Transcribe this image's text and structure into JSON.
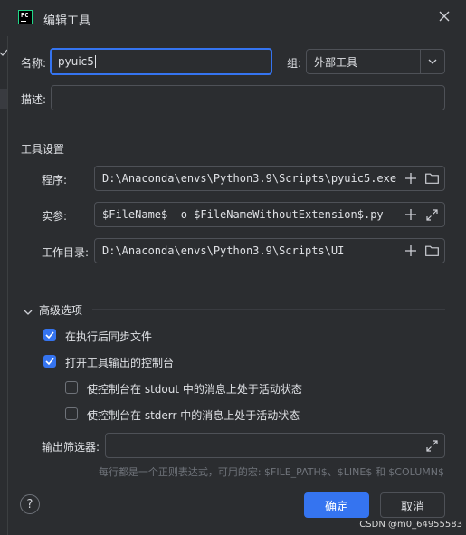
{
  "window": {
    "title": "编辑工具",
    "app_icon_text": "PC"
  },
  "form": {
    "name_label": "名称:",
    "name_value": "pyuic5",
    "group_label": "组:",
    "group_value": "外部工具",
    "description_label": "描述:",
    "description_value": ""
  },
  "tool_settings": {
    "section_title": "工具设置",
    "program_label": "程序:",
    "program_value": "D:\\Anaconda\\envs\\Python3.9\\Scripts\\pyuic5.exe",
    "args_label": "实参:",
    "args_value": "$FileName$ -o $FileNameWithoutExtension$.py",
    "workdir_label": "工作目录:",
    "workdir_value": "D:\\Anaconda\\envs\\Python3.9\\Scripts\\UI"
  },
  "advanced": {
    "section_title": "高级选项",
    "sync_files_label": "在执行后同步文件",
    "sync_files_checked": true,
    "open_console_label": "打开工具输出的控制台",
    "open_console_checked": true,
    "stdout_label": "使控制台在 stdout 中的消息上处于活动状态",
    "stdout_checked": false,
    "stderr_label": "使控制台在 stderr 中的消息上处于活动状态",
    "stderr_checked": false,
    "output_filters_label": "输出筛选器:",
    "output_filters_value": "",
    "hint": "每行都是一个正则表达式，可用的宏: $FILE_PATH$、$LINE$ 和 $COLUMN$"
  },
  "buttons": {
    "ok": "确定",
    "cancel": "取消",
    "help": "?"
  },
  "watermark": "CSDN @m0_64955583",
  "colors": {
    "accent": "#3574f0",
    "background": "#2b2d30",
    "border": "#4e5157"
  }
}
